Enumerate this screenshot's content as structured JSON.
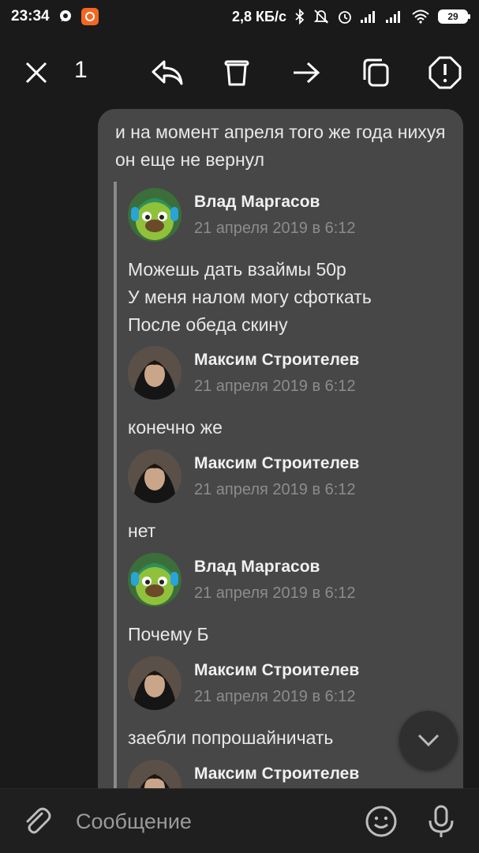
{
  "status_bar": {
    "time": "23:34",
    "network_speed": "2,8 КБ/с",
    "battery": "29",
    "icons": [
      "chat-notification-icon",
      "app-notification-icon",
      "bluetooth-icon",
      "mute-icon",
      "alarm-icon",
      "signal-icon",
      "signal-icon",
      "wifi-icon",
      "battery-icon"
    ]
  },
  "toolbar": {
    "selected_count": "1",
    "icons": [
      "close-icon",
      "reply-icon",
      "delete-icon",
      "forward-icon",
      "copy-icon",
      "report-icon"
    ]
  },
  "message": {
    "text": "и на момент апреля того же года нихуя он еще не вернул",
    "forwarded": [
      {
        "author": "Влад Маргасов",
        "date": "21 апреля 2019 в 6:12",
        "body": "Можешь дать взаймы 50р\nУ меня налом могу сфоткать\nПосле обеда скину",
        "avatar": "green-character"
      },
      {
        "author": "Максим Строителев",
        "date": "21 апреля 2019 в 6:12",
        "body": "конечно же",
        "avatar": "photo-person"
      },
      {
        "author": "Максим Строителев",
        "date": "21 апреля 2019 в 6:12",
        "body": "нет",
        "avatar": "photo-person"
      },
      {
        "author": "Влад Маргасов",
        "date": "21 апреля 2019 в 6:12",
        "body": "Почему Б",
        "avatar": "green-character"
      },
      {
        "author": "Максим Строителев",
        "date": "21 апреля 2019 в 6:12",
        "body": "заебли попрошайничать",
        "avatar": "photo-person"
      },
      {
        "author": "Максим Строителев",
        "date": "",
        "body": "",
        "avatar": "photo-person"
      }
    ]
  },
  "composer": {
    "placeholder": "Сообщение",
    "icons": [
      "attach-icon",
      "emoji-icon",
      "microphone-icon"
    ]
  },
  "colors": {
    "background": "#1a1a1a",
    "bubble": "#474747",
    "date_text": "#8c8c8c"
  }
}
